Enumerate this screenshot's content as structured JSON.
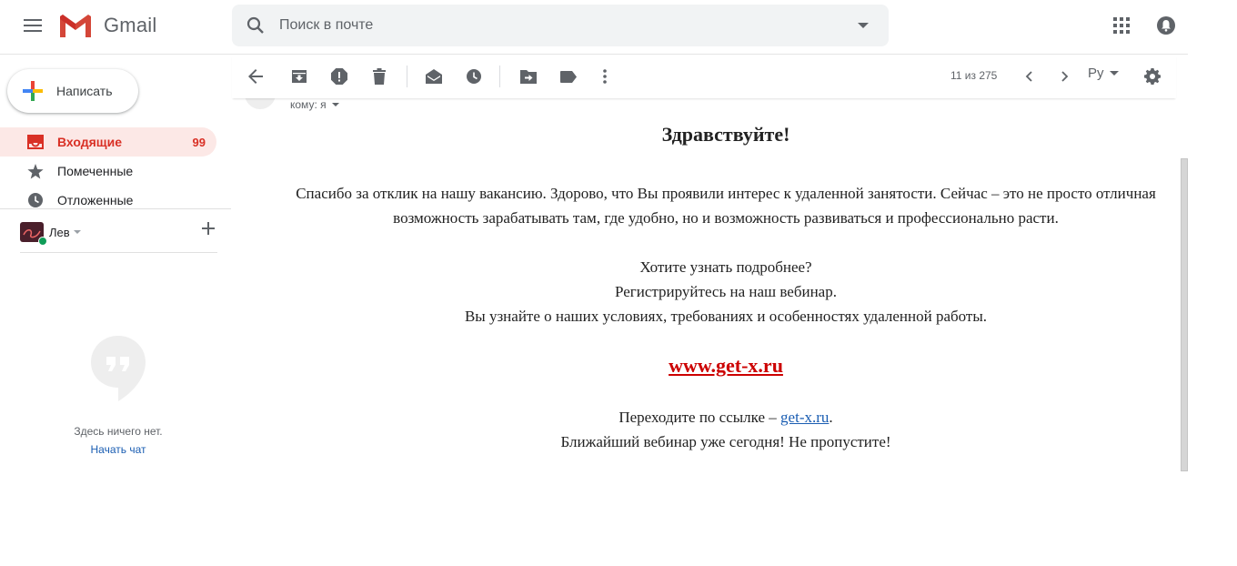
{
  "app": {
    "name": "Gmail"
  },
  "search": {
    "placeholder": "Поиск в почте"
  },
  "compose": {
    "label": "Написать"
  },
  "nav": {
    "items": [
      {
        "label": "Входящие",
        "count": "99"
      },
      {
        "label": "Помеченные"
      },
      {
        "label": "Отложенные"
      }
    ]
  },
  "hangouts": {
    "user": "Лев",
    "empty_text": "Здесь ничего нет.",
    "start_chat": "Начать чат"
  },
  "toolbar": {
    "pager": "11 из 275",
    "lang": "Ру"
  },
  "message": {
    "to": "кому: я",
    "greeting": "Здравствуйте!",
    "paragraph1": "Спасибо за отклик на нашу вакансию. Здорово, что Вы проявили интерес к удаленной занятости. Сейчас – это не просто отличная возможность зарабатывать там, где удобно, но и возможность развиваться и профессионально расти.",
    "line1": "Хотите узнать подробнее?",
    "line2": "Регистрируйтесь на наш вебинар.",
    "line3": "Вы узнайте о наших условиях, требованиях и особенностях удаленной работы.",
    "big_link": "www.get-x.ru",
    "follow_prefix": "Переходите по ссылке – ",
    "follow_link": "get-x.ru",
    "follow_suffix": ".",
    "closing": "Ближайший вебинар уже сегодня! Не пропустите!"
  },
  "colors": {
    "accent_red": "#d93025",
    "link_blue": "#1a5db2",
    "big_link_red": "#cc0000",
    "active_bg": "#fce8e6"
  }
}
